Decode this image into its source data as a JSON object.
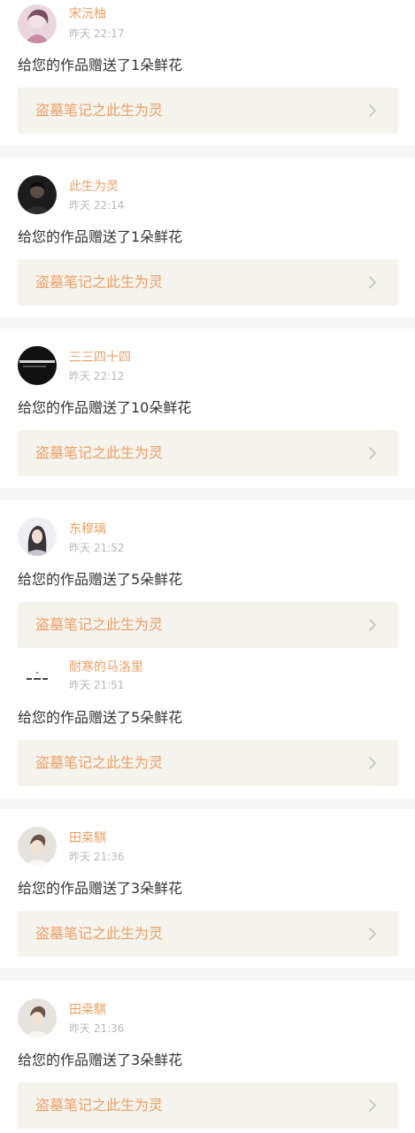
{
  "colors": {
    "accent": "#e8a064",
    "work_title": "#eca06b",
    "work_bg": "#f4f3ec",
    "page_bg": "#f6f6f6",
    "text": "#333333",
    "muted": "#b8b8b8"
  },
  "notifications": [
    {
      "name": "宋沅柚",
      "time": "昨天 22:17",
      "message": "给您的作品赠送了1朵鲜花",
      "work_title": "盗墓笔记之此生为灵",
      "avatar_icon": "avatar-photo-icon",
      "chevron_icon": "chevron-right-icon"
    },
    {
      "name": "此生为灵",
      "time": "昨天 22:14",
      "message": "给您的作品赠送了1朵鲜花",
      "work_title": "盗墓笔记之此生为灵",
      "avatar_icon": "avatar-photo-icon",
      "chevron_icon": "chevron-right-icon"
    },
    {
      "name": "三三四十四",
      "time": "昨天 22:12",
      "message": "给您的作品赠送了10朵鲜花",
      "work_title": "盗墓笔记之此生为灵",
      "avatar_icon": "avatar-photo-icon",
      "chevron_icon": "chevron-right-icon"
    },
    {
      "name": "东穆璃",
      "time": "昨天 21:52",
      "message": "给您的作品赠送了5朵鲜花",
      "work_title": "盗墓笔记之此生为灵",
      "avatar_icon": "avatar-photo-icon",
      "chevron_icon": "chevron-right-icon"
    },
    {
      "name": "耐寒的马洛里",
      "time": "昨天 21:51",
      "message": "给您的作品赠送了5朵鲜花",
      "work_title": "盗墓笔记之此生为灵",
      "avatar_icon": "avatar-photo-icon",
      "chevron_icon": "chevron-right-icon"
    },
    {
      "name": "田桒騏",
      "time": "昨天 21:36",
      "message": "给您的作品赠送了3朵鲜花",
      "work_title": "盗墓笔记之此生为灵",
      "avatar_icon": "avatar-photo-icon",
      "chevron_icon": "chevron-right-icon"
    },
    {
      "name": "田桒騏",
      "time": "昨天 21:36",
      "message": "给您的作品赠送了3朵鲜花",
      "work_title": "盗墓笔记之此生为灵",
      "avatar_icon": "avatar-photo-icon",
      "chevron_icon": "chevron-right-icon"
    }
  ]
}
